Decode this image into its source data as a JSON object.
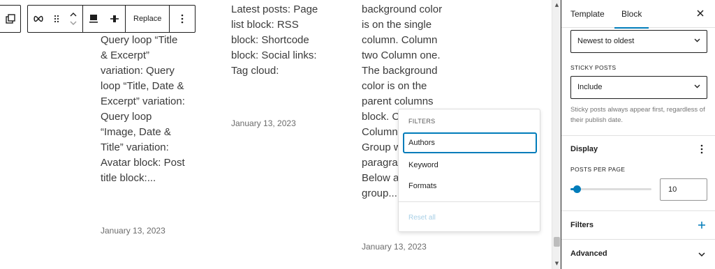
{
  "toolbar": {
    "replace_label": "Replace"
  },
  "posts": {
    "col1_text": "Query loop “Title\n& Excerpt”\nvariation: Query\nloop “Title, Date &\nExcerpt” variation:\nQuery loop\n“Image, Date &\nTitle” variation:\nAvatar block: Post\ntitle block:...",
    "col1_date": "January 13, 2023",
    "col2_text": "Latest posts: Page\nlist block: RSS\nblock: Shortcode\nblock: Social links:\nTag cloud:",
    "col2_date": "January 13, 2023",
    "col3_text": "background color\nis on the single\ncolumn. Column\ntwo Column one.\nThe background\ncolor is on the\nparent columns\nblock. Co\nColumn\nGroup w\nparagrap\nBelow ar\ngroup...",
    "col3_date": "January 13, 2023"
  },
  "filters_menu": {
    "heading": "FILTERS",
    "items": [
      "Authors",
      "Keyword",
      "Formats"
    ],
    "reset_label": "Reset all"
  },
  "sidebar": {
    "tabs": [
      "Template",
      "Block"
    ],
    "active_tab": "Block",
    "order_value": "Newest to oldest",
    "sticky_label": "STICKY POSTS",
    "sticky_value": "Include",
    "sticky_help": "Sticky posts always appear first, regardless of their publish date.",
    "display_title": "Display",
    "posts_per_page_label": "POSTS PER PAGE",
    "posts_per_page_value": "10",
    "posts_per_page_fraction": 0.08,
    "filters_title": "Filters",
    "advanced_title": "Advanced"
  },
  "colors": {
    "accent": "#007cba",
    "text": "#1e1e1e",
    "muted": "#757575"
  }
}
